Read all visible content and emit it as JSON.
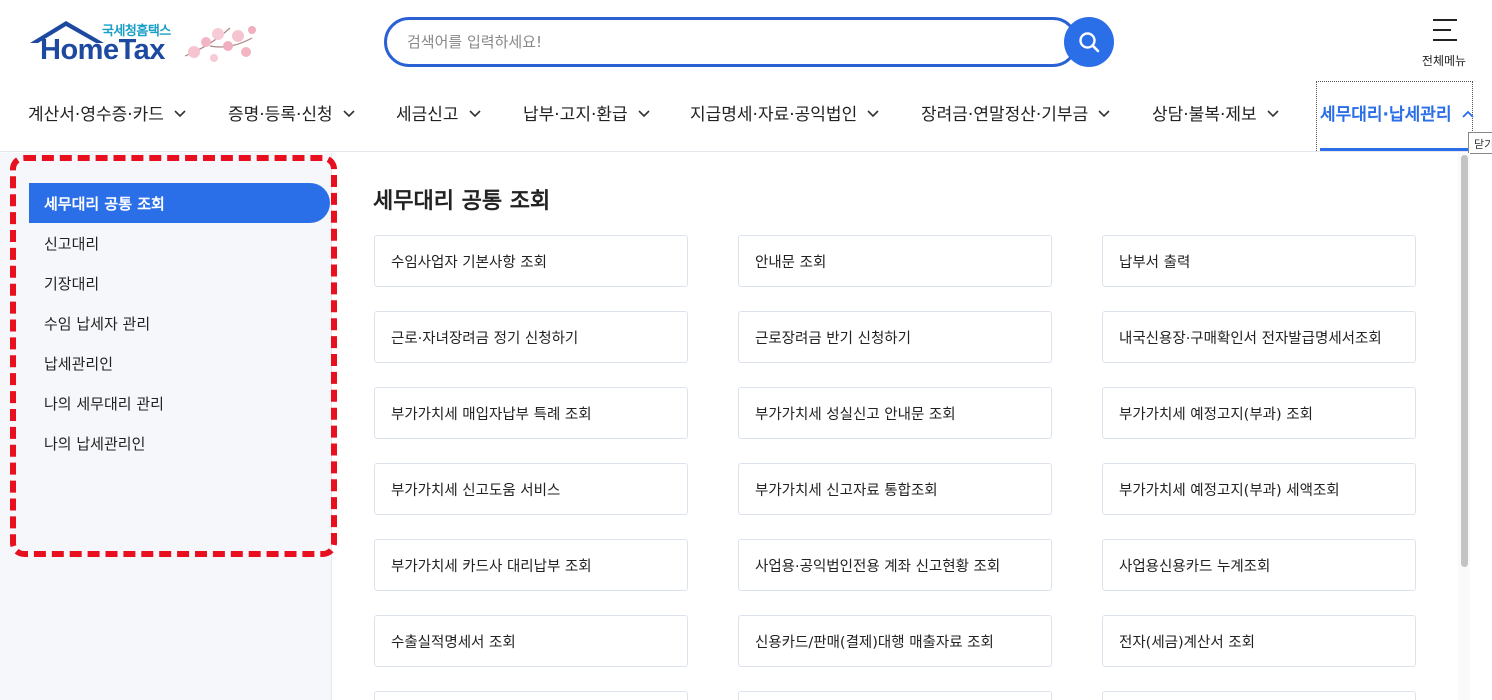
{
  "header": {
    "logo_sub": "국세청홈택스",
    "logo_main": "HomeTax",
    "search_placeholder": "검색어를 입력하세요!",
    "all_menu_label": "전체메뉴"
  },
  "nav": {
    "items": [
      {
        "label": "계산서·영수증·카드"
      },
      {
        "label": "증명·등록·신청"
      },
      {
        "label": "세금신고"
      },
      {
        "label": "납부·고지·환급"
      },
      {
        "label": "지급명세·자료·공익법인"
      },
      {
        "label": "장려금·연말정산·기부금"
      },
      {
        "label": "상담·불복·제보"
      },
      {
        "label": "세무대리·납세관리"
      }
    ],
    "tooltip": "닫기"
  },
  "sidebar": {
    "items": [
      {
        "label": "세무대리 공통 조회"
      },
      {
        "label": "신고대리"
      },
      {
        "label": "기장대리"
      },
      {
        "label": "수임 납세자 관리"
      },
      {
        "label": "납세관리인"
      },
      {
        "label": "나의 세무대리 관리"
      },
      {
        "label": "나의 납세관리인"
      }
    ]
  },
  "main": {
    "title": "세무대리 공통 조회",
    "cards": [
      "수임사업자 기본사항 조회",
      "안내문 조회",
      "납부서 출력",
      "근로·자녀장려금 정기 신청하기",
      "근로장려금 반기 신청하기",
      "내국신용장·구매확인서 전자발급명세서조회",
      "부가가치세 매입자납부 특례 조회",
      "부가가치세 성실신고 안내문 조회",
      "부가가치세 예정고지(부과) 조회",
      "부가가치세 신고도움 서비스",
      "부가가치세 신고자료 통합조회",
      "부가가치세 예정고지(부과) 세액조회",
      "부가가치세 카드사 대리납부 조회",
      "사업용·공익법인전용 계좌 신고현황 조회",
      "사업용신용카드 누계조회",
      "수출실적명세서 조회",
      "신용카드/판매(결제)대행 매출자료 조회",
      "전자(세금)계산서 조회",
      "",
      "",
      ""
    ]
  },
  "colors": {
    "accent": "#2a6ee8",
    "highlight": "#e8101e",
    "logo": "#1d4aa0"
  }
}
